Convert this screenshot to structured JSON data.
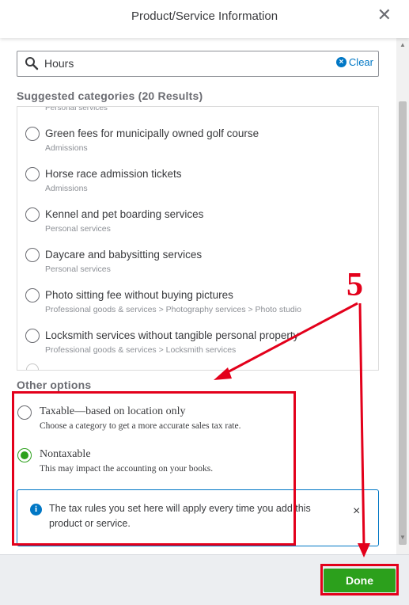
{
  "header": {
    "title": "Product/Service Information",
    "close": "✕"
  },
  "search": {
    "value": "Hours",
    "clear_label": "Clear"
  },
  "suggested": {
    "title": "Suggested categories (20 Results)",
    "partial_above": "Personal services",
    "items": [
      {
        "name": "Green fees for municipally owned golf course",
        "sub": "Admissions"
      },
      {
        "name": "Horse race admission tickets",
        "sub": "Admissions"
      },
      {
        "name": "Kennel and pet boarding services",
        "sub": "Personal services"
      },
      {
        "name": "Daycare and babysitting services",
        "sub": "Personal services"
      },
      {
        "name": "Photo sitting fee without buying pictures",
        "sub": "Professional goods & services > Photography services > Photo studio"
      },
      {
        "name": "Locksmith services without tangible personal property",
        "sub": "Professional goods & services > Locksmith services"
      }
    ]
  },
  "other": {
    "title": "Other options",
    "options": [
      {
        "name": "Taxable—based on location only",
        "sub": "Choose a category to get a more accurate sales tax rate.",
        "checked": false
      },
      {
        "name": "Nontaxable",
        "sub": "This may impact the accounting on your books.",
        "checked": true
      }
    ]
  },
  "info": {
    "text": "The tax rules you set here will apply every time you add this product or service.",
    "close": "×"
  },
  "footer": {
    "done_label": "Done"
  },
  "annotation": {
    "step_number": "5",
    "color": "#e3001b"
  },
  "colors": {
    "accent_green": "#2ca01c",
    "link_blue": "#0077c5"
  }
}
